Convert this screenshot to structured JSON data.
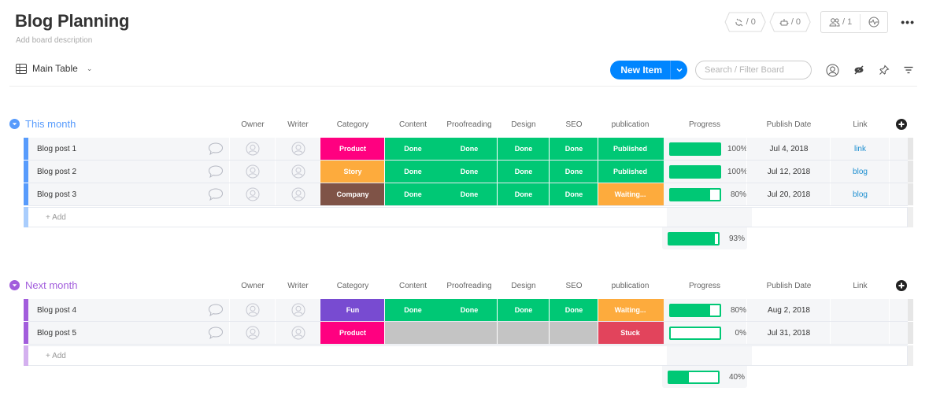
{
  "header": {
    "title": "Blog Planning",
    "description": "Add board description",
    "integrations_count": "/ 0",
    "automations_count": "/ 0",
    "members_count": "/ 1",
    "more_label": "•••"
  },
  "view": {
    "name": "Main Table"
  },
  "toolbar": {
    "new_item_label": "New Item",
    "search_placeholder": "Search / Filter Board"
  },
  "columns": {
    "owner": "Owner",
    "writer": "Writer",
    "category": "Category",
    "content": "Content",
    "proofreading": "Proofreading",
    "design": "Design",
    "seo": "SEO",
    "publication": "publication",
    "progress": "Progress",
    "publish_date": "Publish Date",
    "link": "Link"
  },
  "colors": {
    "accent": "#0085ff",
    "done": "#00c875",
    "product": "#ff0080",
    "story": "#fdab3d",
    "company": "#7f5347",
    "fun": "#784bd1",
    "waiting": "#fdab3d",
    "stuck": "#e2445c",
    "empty": "#c4c4c4",
    "group_this_month": "#579bfc",
    "group_next_month": "#a25ddc"
  },
  "add_label": "+ Add",
  "groups": [
    {
      "title": "This month",
      "color": "#579bfc",
      "light": "#a9cdfd",
      "summary_progress": 93,
      "summary_label": "93%",
      "rows": [
        {
          "name": "Blog post 1",
          "category": "Product",
          "category_color": "#ff0080",
          "content": "Done",
          "proofreading": "Done",
          "design": "Done",
          "seo": "Done",
          "publication": "Published",
          "publication_color": "#00c875",
          "progress": 100,
          "progress_label": "100%",
          "date": "Jul 4, 2018",
          "link": "link"
        },
        {
          "name": "Blog post 2",
          "category": "Story",
          "category_color": "#fdab3d",
          "content": "Done",
          "proofreading": "Done",
          "design": "Done",
          "seo": "Done",
          "publication": "Published",
          "publication_color": "#00c875",
          "progress": 100,
          "progress_label": "100%",
          "date": "Jul 12, 2018",
          "link": "blog"
        },
        {
          "name": "Blog post 3",
          "category": "Company",
          "category_color": "#7f5347",
          "content": "Done",
          "proofreading": "Done",
          "design": "Done",
          "seo": "Done",
          "publication": "Waiting...",
          "publication_color": "#fdab3d",
          "progress": 80,
          "progress_label": "80%",
          "date": "Jul 20, 2018",
          "link": "blog"
        }
      ]
    },
    {
      "title": "Next month",
      "color": "#a25ddc",
      "light": "#d4b0ef",
      "summary_progress": 40,
      "summary_label": "40%",
      "rows": [
        {
          "name": "Blog post 4",
          "category": "Fun",
          "category_color": "#784bd1",
          "content": "Done",
          "proofreading": "Done",
          "design": "Done",
          "seo": "Done",
          "publication": "Waiting...",
          "publication_color": "#fdab3d",
          "progress": 80,
          "progress_label": "80%",
          "date": "Aug 2, 2018",
          "link": ""
        },
        {
          "name": "Blog post 5",
          "category": "Product",
          "category_color": "#ff0080",
          "content": "",
          "proofreading": "",
          "design": "",
          "seo": "",
          "publication": "Stuck",
          "publication_color": "#e2445c",
          "progress": 0,
          "progress_label": "0%",
          "date": "Jul 31, 2018",
          "link": ""
        }
      ]
    }
  ]
}
